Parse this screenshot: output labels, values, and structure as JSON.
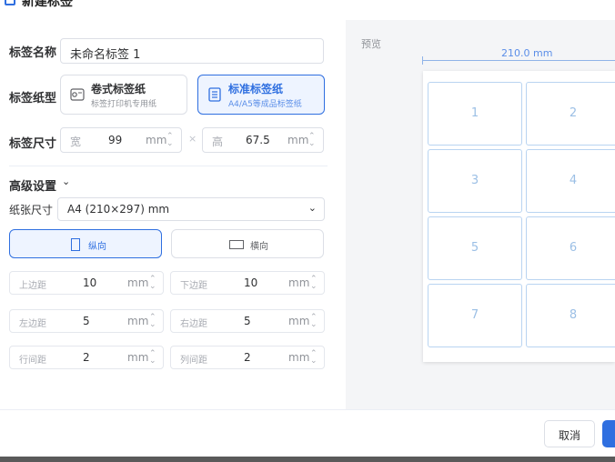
{
  "dialog": {
    "title": "新建标签"
  },
  "form": {
    "name_label": "标签名称",
    "name_value": "未命名标签 1",
    "type_label": "标签纸型",
    "types": [
      {
        "title": "卷式标签纸",
        "subtitle": "标签打印机专用纸",
        "active": false,
        "icon": "roll-label-icon"
      },
      {
        "title": "标准标签纸",
        "subtitle": "A4/A5等成品标签纸",
        "active": true,
        "icon": "sheet-label-icon"
      }
    ],
    "size_label": "标签尺寸",
    "width_prefix": "宽",
    "width_value": "99",
    "height_prefix": "高",
    "height_value": "67.5",
    "unit": "mm",
    "times": "×"
  },
  "advanced": {
    "title": "高级设置",
    "paper_label": "纸张尺寸",
    "paper_value": "A4 (210×297) mm",
    "orientations": [
      {
        "label": "纵向",
        "active": true
      },
      {
        "label": "横向",
        "active": false
      }
    ],
    "margins": {
      "top_label": "上边距",
      "top_value": "10",
      "bottom_label": "下边距",
      "bottom_value": "10",
      "left_label": "左边距",
      "left_value": "5",
      "right_label": "右边距",
      "right_value": "5",
      "row_gap_label": "行间距",
      "row_gap_value": "2",
      "col_gap_label": "列间距",
      "col_gap_value": "2"
    }
  },
  "preview": {
    "title": "预览",
    "width_dim": "210.0 mm",
    "cells": [
      "1",
      "2",
      "3",
      "4",
      "5",
      "6",
      "7",
      "8"
    ]
  },
  "footer": {
    "cancel_label": "取消"
  },
  "colors": {
    "accent": "#2f6fe0",
    "preview_bg": "#f4f5f7",
    "cell_border": "#b9d4f1"
  }
}
